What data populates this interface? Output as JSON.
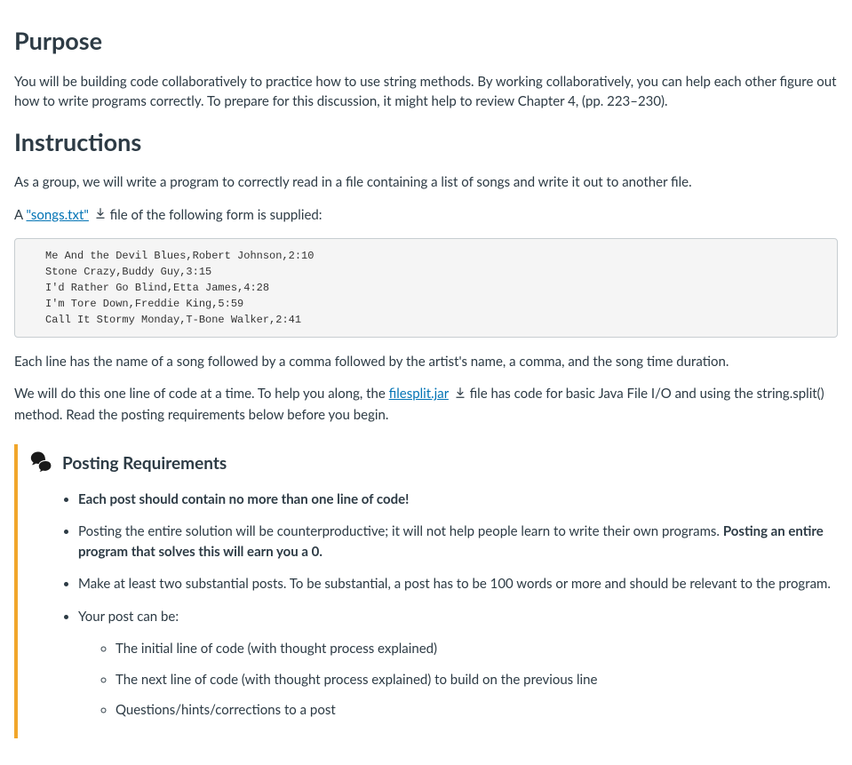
{
  "purpose": {
    "heading": "Purpose",
    "paragraph": "You will be building code collaboratively to practice how to use string methods. By working collaboratively, you can help each other figure out how to write programs correctly. To prepare for this discussion, it might help to review Chapter 4, (pp. 223–230)."
  },
  "instructions": {
    "heading": "Instructions",
    "intro": "As a group, we will write a program to correctly read in a file containing a list of songs and write it out to another file.",
    "file_sentence_prefix": "A ",
    "songs_link": "\"songs.txt\"",
    "file_sentence_suffix": " file of the following form is supplied:",
    "code": "Me And the Devil Blues,Robert Johnson,2:10\nStone Crazy,Buddy Guy,3:15\nI'd Rather Go Blind,Etta James,4:28\nI'm Tore Down,Freddie King,5:59\nCall It Stormy Monday,T-Bone Walker,2:41",
    "each_line": "Each line has the name of a song followed by a comma followed by the artist's name, a comma, and the song time duration.",
    "helper_prefix": "We will do this one line of code at a time. To help you along, the ",
    "filesplit_link": "filesplit.jar",
    "helper_suffix": " file has code for basic Java File I/O and using the string.split() method. Read the posting requirements below before you begin."
  },
  "requirements": {
    "title": "Posting Requirements",
    "items": [
      {
        "bold_full": "Each post should contain no more than one line of code!"
      },
      {
        "text_before": "Posting the entire solution will be counterproductive; it will not help people learn to write their own programs. ",
        "bold_after": "Posting an entire program that solves this will earn you a 0."
      },
      {
        "text": "Make at least two substantial posts. To be substantial, a post has to be 100 words or more and should be relevant to the program."
      },
      {
        "text": "Your post can be:",
        "sub": [
          "The initial line of code (with thought process explained)",
          "The next line of code (with thought process explained) to build on the previous line",
          "Questions/hints/corrections to a post"
        ]
      }
    ]
  }
}
